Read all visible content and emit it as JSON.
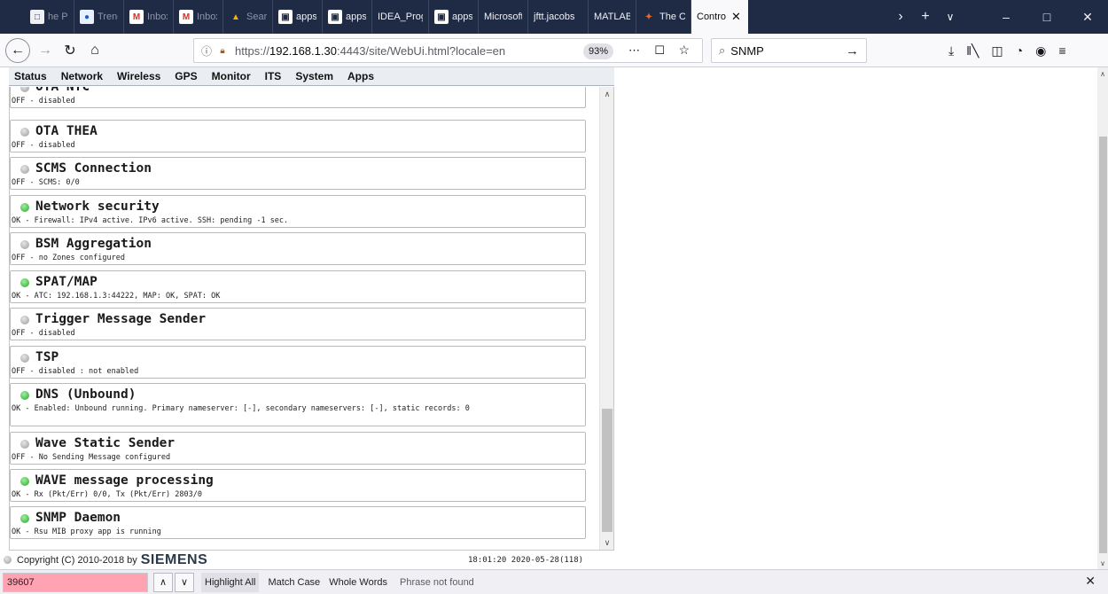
{
  "browser": {
    "tabs": [
      {
        "label": "he Pi",
        "icon": "page-icon",
        "dim": true
      },
      {
        "label": "Trend",
        "icon": "trend-icon",
        "dim": true
      },
      {
        "label": "Inbox",
        "icon": "gmail-icon",
        "dim": true
      },
      {
        "label": "Inbox",
        "icon": "gmail-icon",
        "dim": true
      },
      {
        "label": "Search",
        "icon": "drive-icon",
        "dim": true
      },
      {
        "label": "apps.t",
        "icon": "apps-icon",
        "dim": false
      },
      {
        "label": "apps.t",
        "icon": "apps-icon",
        "dim": false
      },
      {
        "label": "IDEA_Prog",
        "icon": "",
        "dim": false
      },
      {
        "label": "apps.t",
        "icon": "apps-icon",
        "dim": false
      },
      {
        "label": "Microsoft",
        "icon": "",
        "dim": false
      },
      {
        "label": "jftt.jacobs",
        "icon": "",
        "dim": false
      },
      {
        "label": "MATLAB",
        "icon": "",
        "dim": false
      },
      {
        "label": "The C",
        "icon": "matlab-icon",
        "dim": false
      },
      {
        "label": "Contro",
        "icon": "",
        "dim": false,
        "active": true
      }
    ],
    "url_prefix": "https://",
    "url_host": "192.168.1.30",
    "url_rest": ":4443/site/WebUi.html?locale=en",
    "zoom": "93%",
    "search_value": "SNMP"
  },
  "menu": [
    "Status",
    "Network",
    "Wireless",
    "GPS",
    "Monitor",
    "ITS",
    "System",
    "Apps"
  ],
  "services": [
    {
      "title": "OTA NYC",
      "status": "OFF - disabled",
      "state": "off"
    },
    {
      "title": "OTA THEA",
      "status": "OFF - disabled",
      "state": "off"
    },
    {
      "title": "SCMS Connection",
      "status": "OFF - SCMS: 0/0",
      "state": "off"
    },
    {
      "title": "Network security",
      "status": "OK - Firewall: IPv4 active. IPv6 active. SSH: pending -1 sec.",
      "state": "ok"
    },
    {
      "title": "BSM Aggregation",
      "status": "OFF - no Zones configured",
      "state": "off"
    },
    {
      "title": "SPAT/MAP",
      "status": "OK - ATC: 192.168.1.3:44222, MAP: OK, SPAT: OK",
      "state": "ok"
    },
    {
      "title": "Trigger Message Sender",
      "status": "OFF - disabled",
      "state": "off"
    },
    {
      "title": "TSP",
      "status": "OFF - disabled : not enabled",
      "state": "off"
    },
    {
      "title": "DNS (Unbound)",
      "status": "OK - Enabled: Unbound running. Primary nameserver: [-], secondary nameservers: [-], static records: 0",
      "state": "ok"
    },
    {
      "title": "Wave Static Sender",
      "status": "OFF - No Sending Message configured",
      "state": "off"
    },
    {
      "title": "WAVE message processing",
      "status": "OK - Rx (Pkt/Err) 0/0, Tx (Pkt/Err) 2803/0",
      "state": "ok"
    },
    {
      "title": "SNMP Daemon",
      "status": "OK - Rsu MIB proxy app is running",
      "state": "ok"
    }
  ],
  "footer": {
    "copyright": "Copyright (C) 2010-2018 by",
    "brand": "SIEMENS",
    "clock": "18:01:20 2020-05-28(118)"
  },
  "findbar": {
    "value": "39607",
    "highlight_all": "Highlight All",
    "match_case": "Match Case",
    "whole_words": "Whole Words",
    "status": "Phrase not found"
  },
  "colors": {
    "ok_led": "#2aa52a",
    "off_led": "#9a9a9a",
    "tabbar_bg": "#1f2a44",
    "find_not_found": "#ffa3b3"
  }
}
